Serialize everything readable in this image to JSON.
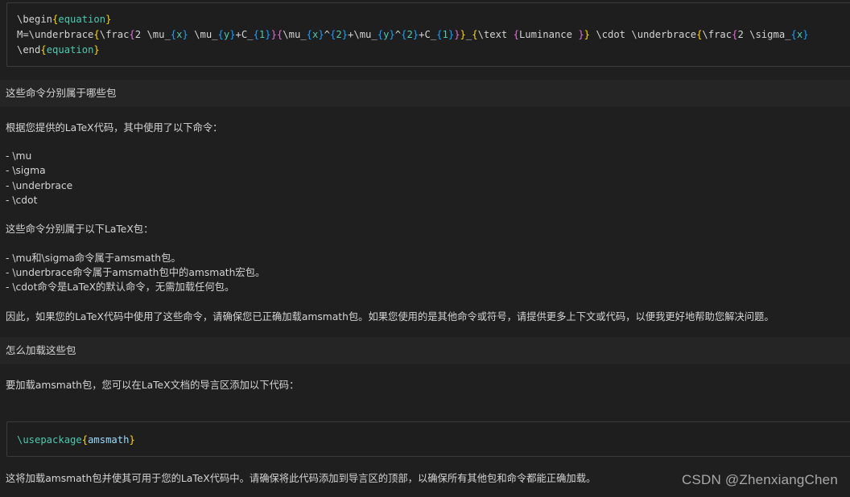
{
  "code_block_1": {
    "line1_cmd": "\\begin",
    "line1_arg": "equation",
    "line2_prefix": "M=\\underbrace",
    "line2_frac": "\\frac",
    "line2_num_a": "2 \\mu_",
    "line2_x": "x",
    "line2_num_b": " \\mu_",
    "line2_y": "y",
    "line2_num_c": "+C_",
    "line2_one": "1",
    "line2_den_a": "\\mu_",
    "line2_den_x": "x",
    "line2_den_b": "^",
    "line2_den_two": "2",
    "line2_den_c": "+\\mu_",
    "line2_den_y": "y",
    "line2_den_d": "^",
    "line2_den_two_b": "2",
    "line2_den_e": "+C_",
    "line2_den_one": "1",
    "line2_sub": "_",
    "line2_text_cmd": "\\text ",
    "line2_text_arg": "Luminance ",
    "line2_cdot": " \\cdot \\underbrace",
    "line2_frac2": "\\frac",
    "line2_sigma": "2 \\sigma_",
    "line2_sigma_x": "x",
    "line3_cmd": "\\end",
    "line3_arg": "equation"
  },
  "question_1": "这些命令分别属于哪些包",
  "answer_1": {
    "intro": "根据您提供的LaTeX代码，其中使用了以下命令：",
    "commands": [
      "- \\mu",
      "- \\sigma",
      "- \\underbrace",
      "- \\cdot"
    ],
    "packages_intro": "这些命令分别属于以下LaTeX包：",
    "packages": [
      "- \\mu和\\sigma命令属于amsmath包。",
      "- \\underbrace命令属于amsmath包中的amsmath宏包。",
      "- \\cdot命令是LaTeX的默认命令，无需加载任何包。"
    ],
    "conclusion": "因此，如果您的LaTeX代码中使用了这些命令，请确保您已正确加载amsmath包。如果您使用的是其他命令或符号，请提供更多上下文或代码，以便我更好地帮助您解决问题。"
  },
  "question_2": "怎么加载这些包",
  "answer_2": {
    "intro": "要加载amsmath包，您可以在LaTeX文档的导言区添加以下代码：",
    "outro": "这将加载amsmath包并使其可用于您的LaTeX代码中。请确保将此代码添加到导言区的顶部，以确保所有其他包和命令都能正确加载。"
  },
  "code_block_2": {
    "cmd": "\\usepackage",
    "arg": "amsmath"
  },
  "watermark": "CSDN @ZhenxiangChen",
  "colors": {
    "background": "#1f1f1f",
    "question_bar": "#252526",
    "brace_gold": "#ffd700",
    "brace_purple": "#da70d6",
    "brace_blue": "#179fff",
    "arg_teal": "#4ec9b0"
  }
}
